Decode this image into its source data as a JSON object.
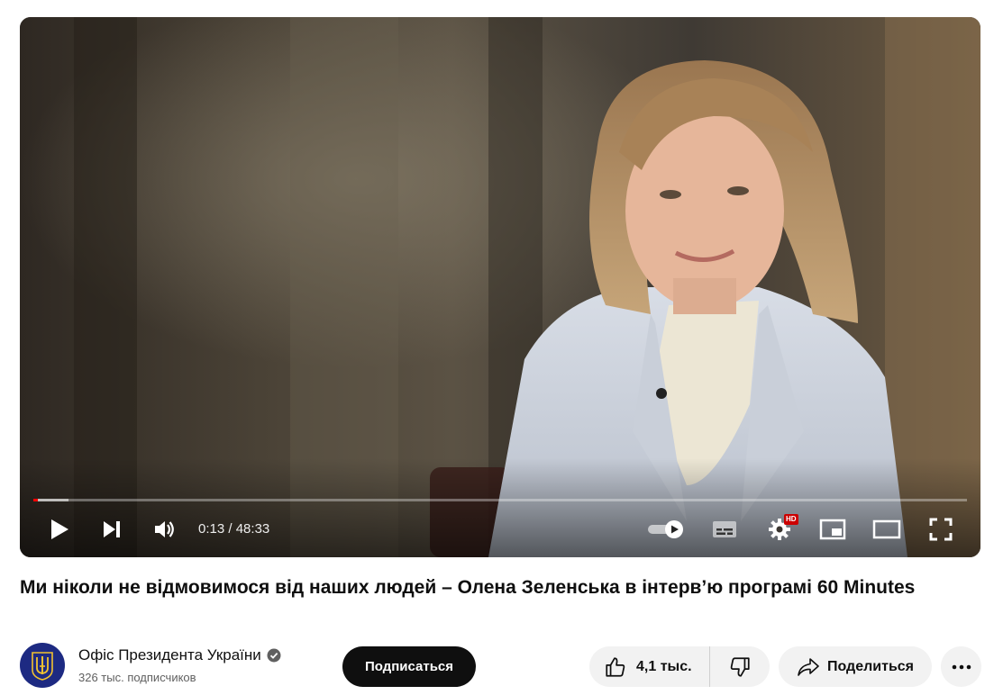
{
  "player": {
    "time_current": "0:13",
    "time_separator": " / ",
    "time_total": "48:33",
    "progress_played_fraction": 0.0045,
    "progress_loaded_fraction": 0.038,
    "quality_badge": "HD",
    "autoplay_on": true,
    "controls": [
      "play-icon",
      "next-icon",
      "volume-icon",
      "autoplay-toggle",
      "subtitles-icon",
      "settings-icon",
      "miniplayer-icon",
      "theater-mode-icon",
      "fullscreen-icon"
    ],
    "accent_color": "#ff0000"
  },
  "video": {
    "title": "Ми ніколи не відмовимося від наших людей – Олена Зеленська в інтерв’ю програмі 60 Minutes"
  },
  "channel": {
    "name": "Офіс Президента України",
    "verified_icon": "verified-check-icon",
    "subscribers": "326 тыс. подписчиков",
    "avatar_icon": "trident-emblem-icon",
    "avatar_color": "#1d2a82"
  },
  "actions": {
    "subscribe_label": "Подписаться",
    "like_count": "4,1 тыс.",
    "like_icon": "thumbs-up-icon",
    "dislike_icon": "thumbs-down-icon",
    "share_label": "Поделиться",
    "share_icon": "share-arrow-icon",
    "more_icon": "more-horizontal-icon"
  }
}
